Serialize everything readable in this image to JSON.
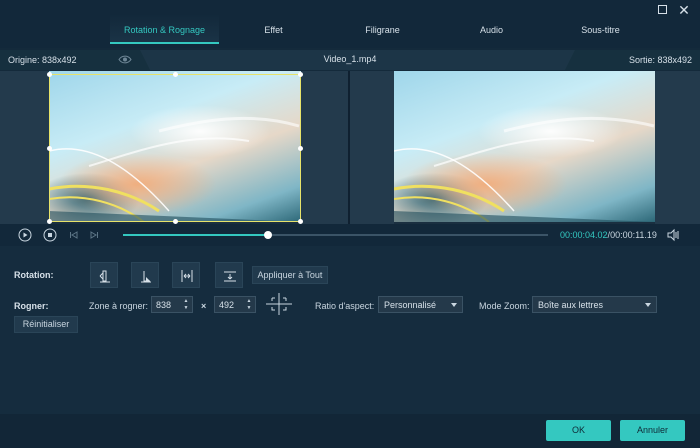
{
  "tabs": [
    {
      "label": "Rotation & Rognage",
      "active": true
    },
    {
      "label": "Effet",
      "active": false
    },
    {
      "label": "Filigrane",
      "active": false
    },
    {
      "label": "Audio",
      "active": false
    },
    {
      "label": "Sous-titre",
      "active": false
    }
  ],
  "window": {
    "maximize_icon": "maximize-icon",
    "close_icon": "close-icon",
    "close_glyph": "✕"
  },
  "info": {
    "origin": "Origine: 838x492",
    "file_name": "Video_1.mp4",
    "output": "Sortie: 838x492"
  },
  "playback": {
    "current": "00:00:04.02",
    "separator": "/",
    "total": "00:00:11.19",
    "progress": 0.34
  },
  "rotation": {
    "label": "Rotation:",
    "apply_all": "Appliquer à Tout"
  },
  "crop": {
    "label": "Rogner:",
    "area_label": "Zone à rogner:",
    "width": "838",
    "times": "×",
    "height": "492",
    "aspect_label": "Ratio d'aspect:",
    "aspect_value": "Personnalisé",
    "zoom_label": "Mode Zoom:",
    "zoom_value": "Boîte aux lettres",
    "reset": "Réinitialiser"
  },
  "footer": {
    "ok": "OK",
    "cancel": "Annuler"
  },
  "colors": {
    "accent": "#34c8c0",
    "crop_border": "#e7e36a",
    "background": "#142a3b"
  }
}
